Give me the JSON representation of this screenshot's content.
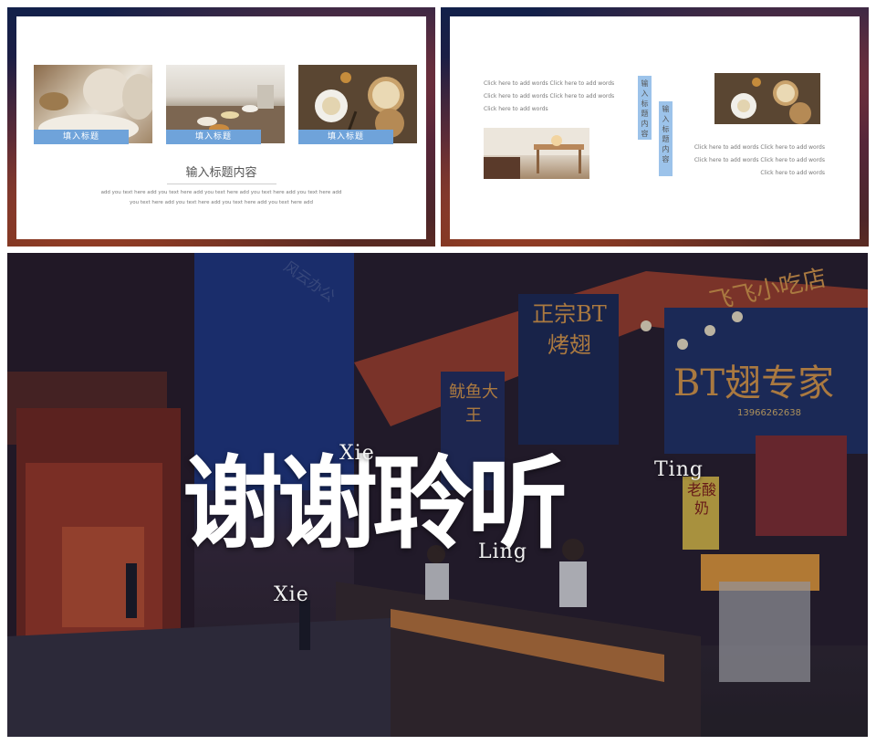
{
  "slide1": {
    "tags": [
      "填入标题",
      "填入标题",
      "填入标题"
    ],
    "heading": "输入标题内容",
    "body_lines": [
      "add you text here add you text here add you text here add you text here add you text here add",
      "you text here add you text here add you text here add you text here add"
    ]
  },
  "slide2": {
    "left_lines": [
      "Click here to add words Click here to add words",
      "Click here to add words  Click here to add words",
      "Click here to add words"
    ],
    "vtags": [
      "输入标题内容",
      "输入标题内容"
    ],
    "right_lines": [
      "Click here to add words Click here to add words",
      "Click here to add words  Click here to add words",
      "Click here to add words"
    ]
  },
  "closing": {
    "title": "谢谢聆听",
    "pinyin": [
      "Xie",
      "Xie",
      "Ling",
      "Ting"
    ],
    "watermark": "风云办公",
    "signs": {
      "sign_a": "正宗BT烤翅",
      "sign_b": "BT翅专家",
      "sign_c": "飞飞小吃店",
      "sign_d": "老酸奶",
      "sign_e": "鱿鱼大王",
      "phone": "13966262638"
    }
  },
  "colors": {
    "tag_blue": "#6fa3da",
    "vtag_blue": "#9cc3ea"
  }
}
